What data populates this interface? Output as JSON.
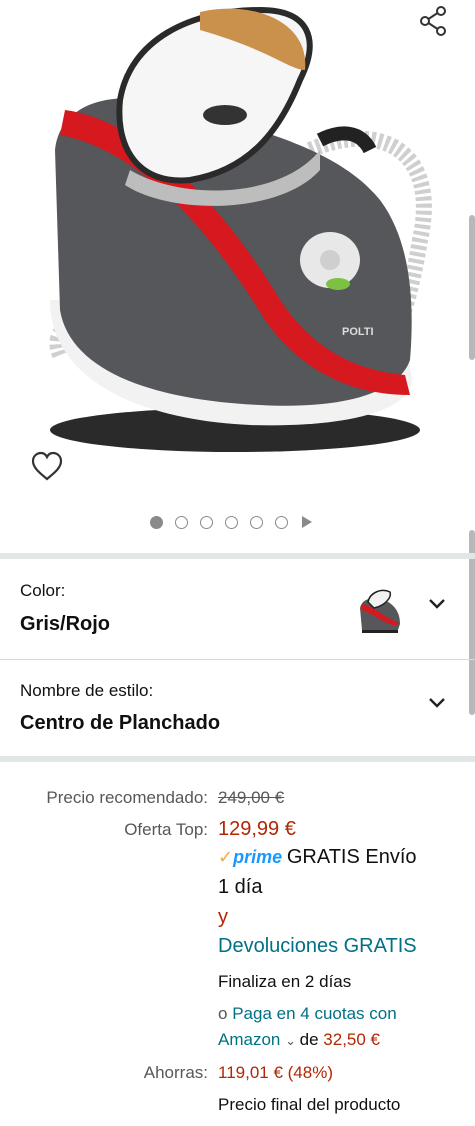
{
  "gallery": {
    "image_alt": "Polti Vaporella steam generator iron",
    "image_count": 6,
    "active_index": 0
  },
  "variants": {
    "color": {
      "label": "Color:",
      "value": "Gris/Rojo"
    },
    "style": {
      "label": "Nombre de estilo:",
      "value": "Centro de Planchado"
    }
  },
  "pricing": {
    "list_price_label": "Precio recomendado:",
    "list_price": "249,00 €",
    "deal_label": "Oferta Top:",
    "deal_price": "129,99 €",
    "prime_logo": "prime",
    "delivery_line1": "GRATIS Envío",
    "delivery_line2": "1 día",
    "and_text": "y",
    "returns": "Devoluciones GRATIS",
    "ends": "Finaliza en 2 días",
    "installments_prefix": "o",
    "installments_link_1": "Paga en 4 cuotas con",
    "installments_link_2": "Amazon",
    "installments_de": "de",
    "installments_amount": "32,50 €",
    "savings_label": "Ahorras:",
    "savings_value": "119,01 € (48%)",
    "final_price": "Precio final del producto"
  },
  "colors": {
    "price_red": "#b12704",
    "link_teal": "#007185",
    "prime_blue": "#1a98ff"
  },
  "icons": {
    "share": "share-icon",
    "heart": "heart-icon",
    "chevron": "chevron-down-icon"
  }
}
